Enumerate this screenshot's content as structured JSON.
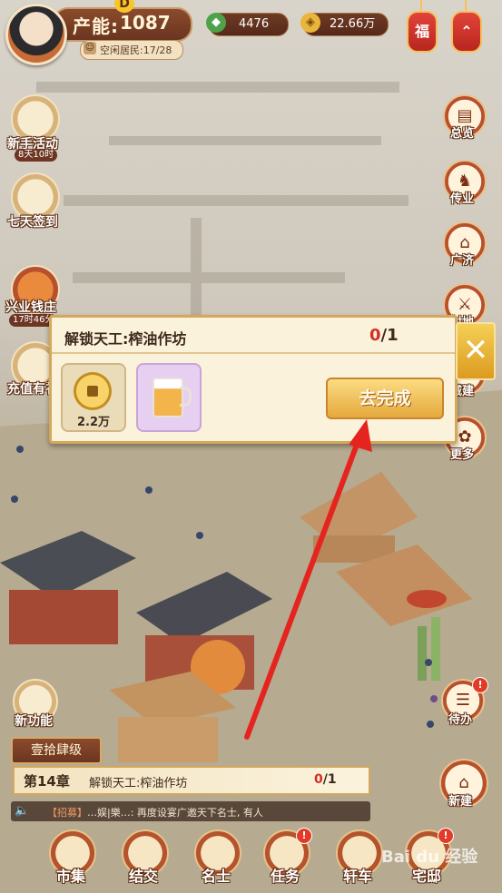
{
  "header": {
    "prod_label": "产能:",
    "prod_value": "1087",
    "idle_residents": "空闲居民:17/28",
    "jade_value": "4476",
    "coin_value": "22.66万",
    "badge_letter": "D"
  },
  "lanterns": [
    "福",
    "⌃"
  ],
  "left_events": [
    {
      "label": "新手活动",
      "timer": "8天10时"
    },
    {
      "label": "七天签到",
      "timer": ""
    },
    {
      "label": "兴业钱庄",
      "timer": "17时46分"
    },
    {
      "label": "充值有礼",
      "timer": ""
    }
  ],
  "right_menu": [
    {
      "label": "总览",
      "icon": "ledger-icon"
    },
    {
      "label": "传业",
      "icon": "horse-icon"
    },
    {
      "label": "广济",
      "icon": "bowl-icon"
    },
    {
      "label": "封地",
      "icon": "sword-icon"
    },
    {
      "label": "城建",
      "icon": "hammer-icon"
    },
    {
      "label": "更多",
      "icon": "flower-icon"
    }
  ],
  "popup": {
    "title": "解锁天工:榨油作坊",
    "progress_done": "0",
    "progress_total": "/1",
    "coin_amount": "2.2万",
    "go_button": "去完成",
    "close_symbol": "✕"
  },
  "left_extra": {
    "new_feature": "新功能"
  },
  "right_extra": {
    "pending": "待办",
    "build": "新建"
  },
  "chapter": {
    "level_tag": "壹拾肆级",
    "chapter_label": "第14章",
    "quest_name": "解锁天工:榨油作坊",
    "progress_done": "0",
    "progress_total": "/1"
  },
  "news": {
    "tag": "【招募】",
    "text": "…娱|樂…: 再度设宴广邀天下名士, 有人"
  },
  "bottom_nav": [
    {
      "label": "市集",
      "badge": ""
    },
    {
      "label": "结交",
      "badge": ""
    },
    {
      "label": "名士",
      "badge": ""
    },
    {
      "label": "任务",
      "badge": "!"
    },
    {
      "label": "轩车",
      "badge": ""
    },
    {
      "label": "宅邸",
      "badge": "!"
    }
  ],
  "watermark": "Bai du 经验",
  "colors": {
    "accent_red": "#d42e20",
    "gold": "#e5a93d",
    "brown": "#6a3520"
  }
}
